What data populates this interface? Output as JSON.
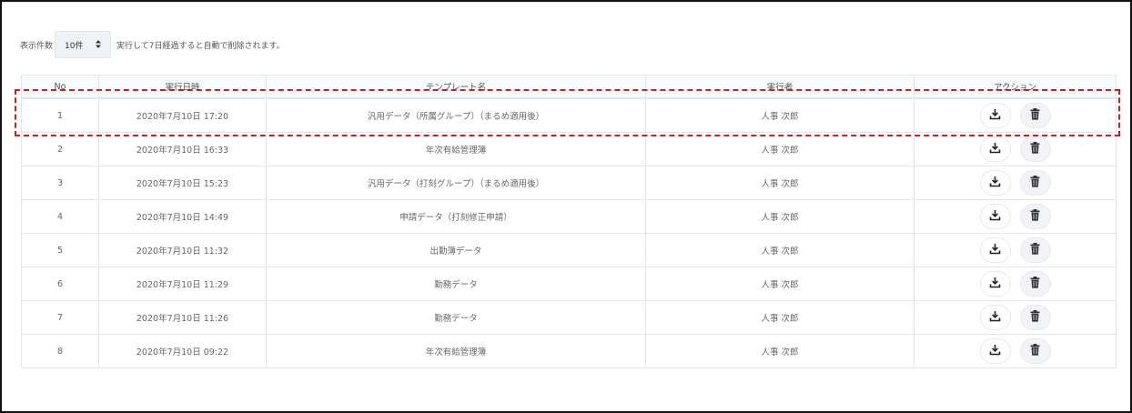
{
  "controls": {
    "page_size_label": "表示件数",
    "page_size_value": "10件",
    "page_size_caret": "▲▼",
    "notice": "実行して7日経過すると自動で削除されます。"
  },
  "table": {
    "headers": [
      "No",
      "実行日時",
      "テンプレート名",
      "実行者",
      "アクション"
    ],
    "rows": [
      {
        "no": "1",
        "datetime": "2020年7月10日 17:20",
        "template": "汎用データ（所属グループ）（まるめ適用後）",
        "executor": "人事 次郎"
      },
      {
        "no": "2",
        "datetime": "2020年7月10日 16:33",
        "template": "年次有給管理簿",
        "executor": "人事 次郎"
      },
      {
        "no": "3",
        "datetime": "2020年7月10日 15:23",
        "template": "汎用データ（打刻グループ）（まるめ適用後）",
        "executor": "人事 次郎"
      },
      {
        "no": "4",
        "datetime": "2020年7月10日 14:49",
        "template": "申請データ（打刻修正申請）",
        "executor": "人事 次郎"
      },
      {
        "no": "5",
        "datetime": "2020年7月10日 11:32",
        "template": "出勤簿データ",
        "executor": "人事 次郎"
      },
      {
        "no": "6",
        "datetime": "2020年7月10日 11:29",
        "template": "勤務データ",
        "executor": "人事 次郎"
      },
      {
        "no": "7",
        "datetime": "2020年7月10日 11:26",
        "template": "勤務データ",
        "executor": "人事 次郎"
      },
      {
        "no": "8",
        "datetime": "2020年7月10日 09:22",
        "template": "年次有給管理簿",
        "executor": "人事 次郎"
      }
    ],
    "action_icons": {
      "download": "download-icon",
      "delete": "trash-icon"
    }
  },
  "highlight": {
    "color": "#cc1f1f"
  }
}
